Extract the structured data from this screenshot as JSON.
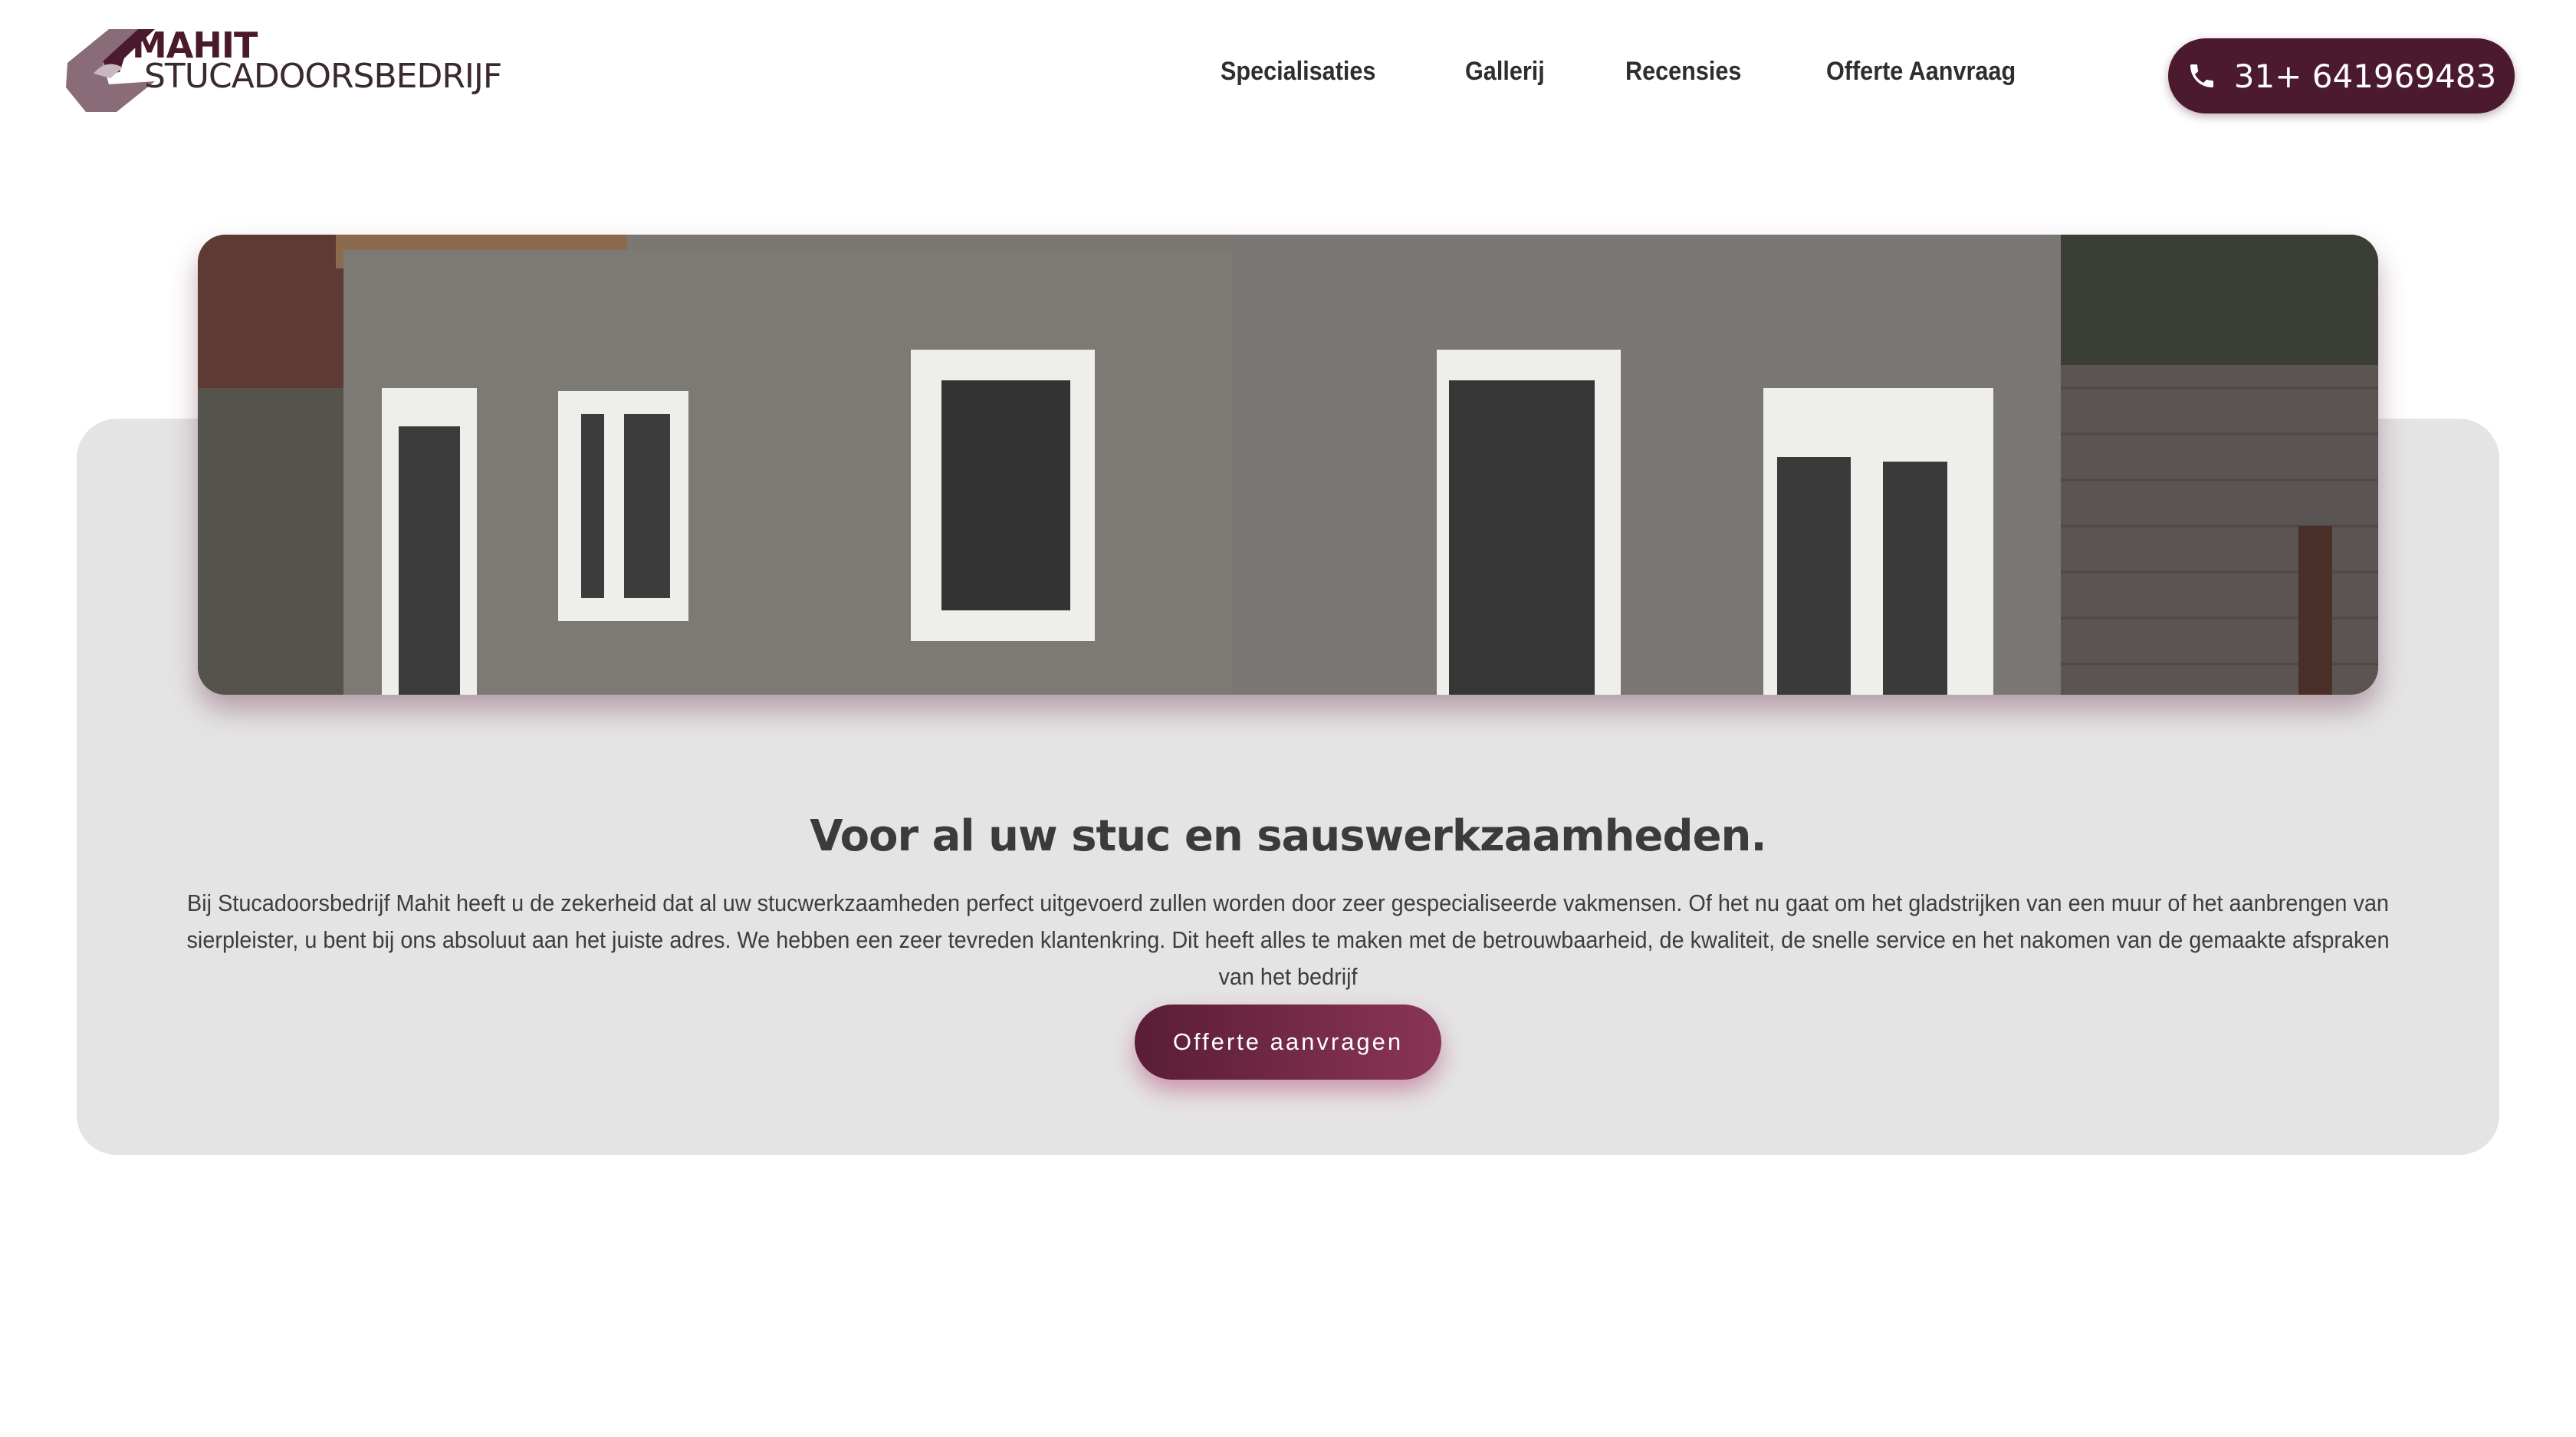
{
  "brand": {
    "title": "MAHIT",
    "subtitle": "STUCADOORSBEDRIJF",
    "logo_icon": "trowel-logo-icon",
    "primary_color": "#4b1a2e",
    "accent_color": "#8a3556"
  },
  "nav": {
    "items": [
      {
        "label": "Specialisaties"
      },
      {
        "label": "Gallerij"
      },
      {
        "label": "Recensies"
      },
      {
        "label": "Offerte Aanvraag"
      }
    ]
  },
  "phone": {
    "icon": "phone-icon",
    "number": "31+ 641969483"
  },
  "hero": {
    "image": "house-facade-photo",
    "headline": "Voor al uw stuc en sauswerkzaamheden.",
    "body": "Bij Stucadoorsbedrijf Mahit heeft u de zekerheid dat al uw stucwerkzaamheden perfect uitgevoerd zullen worden door zeer gespecialiseerde vakmensen. Of het nu gaat om het gladstrijken van een muur of het aanbrengen van sierpleister, u bent bij ons absoluut aan het juiste adres. We hebben een zeer tevreden klantenkring. Dit heeft alles te maken met de betrouwbaarheid, de kwaliteit, de snelle service en het nakomen van de gemaakte afspraken van het bedrijf",
    "cta_label": "Offerte aanvragen"
  }
}
